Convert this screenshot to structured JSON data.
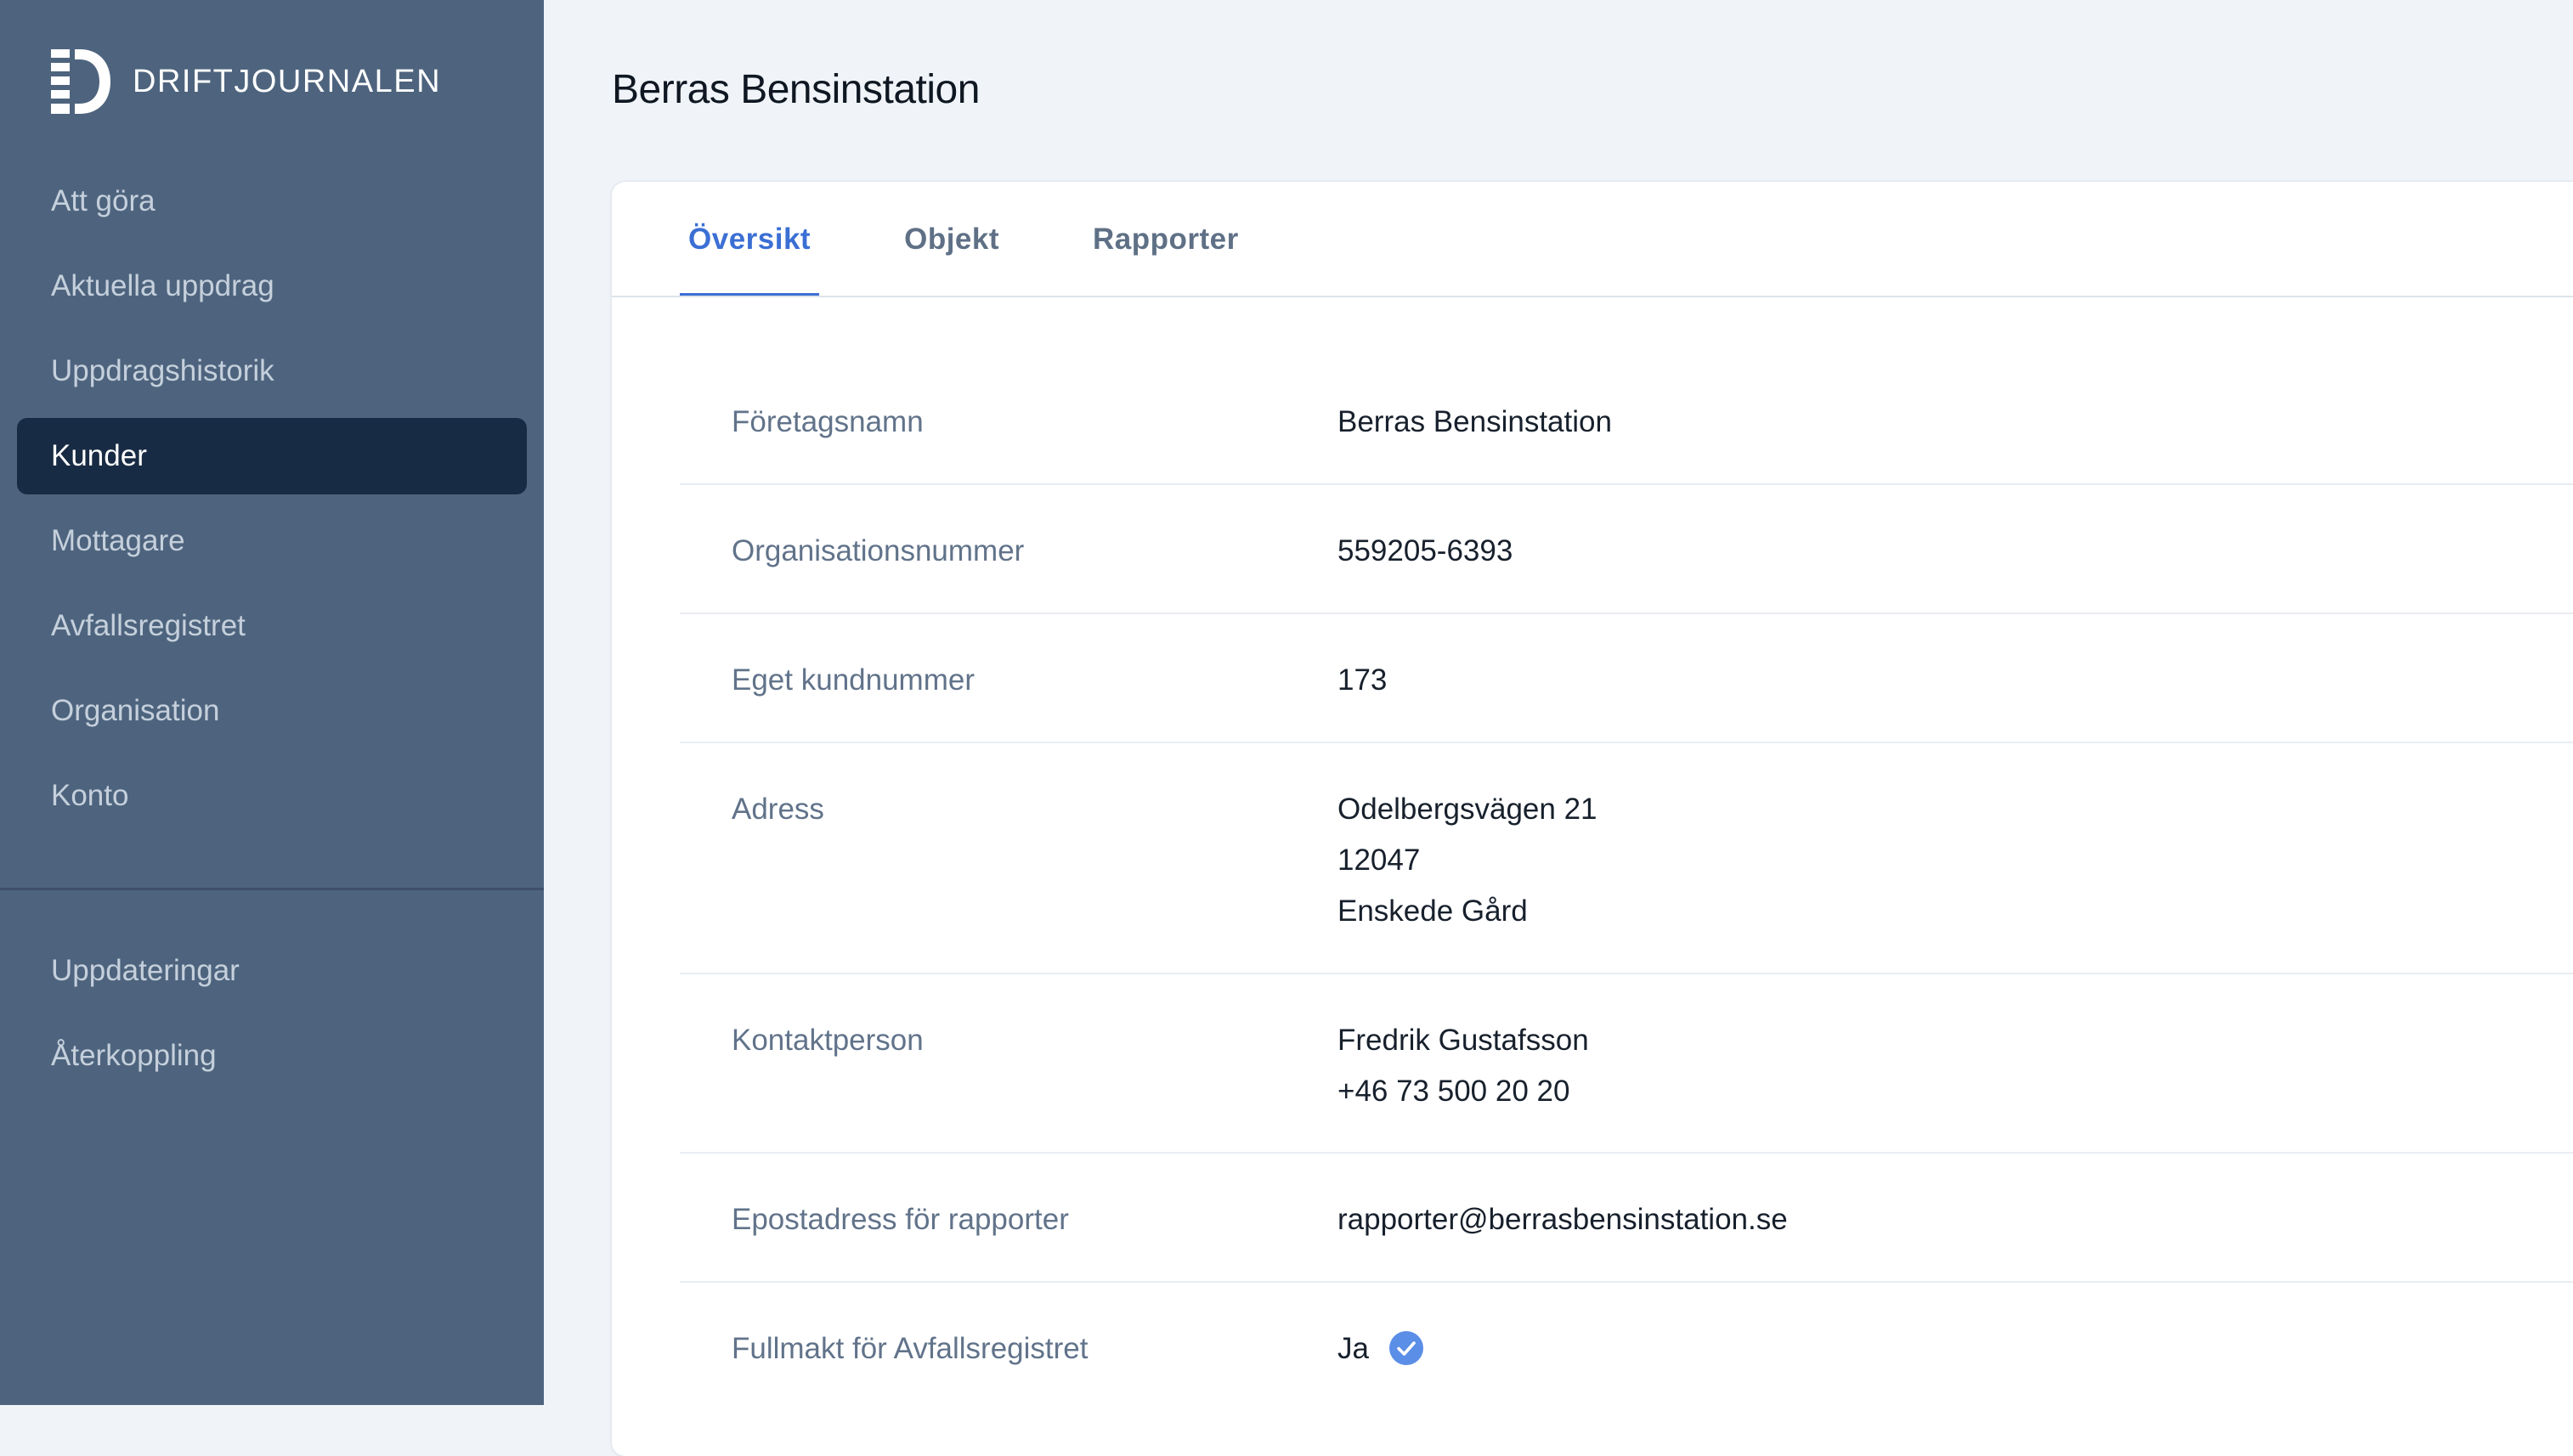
{
  "brand": {
    "name": "DRIFTJOURNALEN",
    "logo_icon": "driftjournalen-logo-icon"
  },
  "sidebar": {
    "items": [
      {
        "label": "Att göra"
      },
      {
        "label": "Aktuella uppdrag"
      },
      {
        "label": "Uppdragshistorik"
      },
      {
        "label": "Kunder",
        "active": true
      },
      {
        "label": "Mottagare"
      },
      {
        "label": "Avfallsregistret"
      },
      {
        "label": "Organisation"
      },
      {
        "label": "Konto"
      }
    ],
    "secondary_items": [
      {
        "label": "Uppdateringar"
      },
      {
        "label": "Återkoppling"
      }
    ]
  },
  "page": {
    "title": "Berras Bensinstation"
  },
  "tabs": [
    {
      "label": "Översikt",
      "active": true
    },
    {
      "label": "Objekt"
    },
    {
      "label": "Rapporter"
    }
  ],
  "details": {
    "company_name": {
      "label": "Företagsnamn",
      "value": "Berras Bensinstation"
    },
    "org_number": {
      "label": "Organisationsnummer",
      "value": "559205-6393"
    },
    "customer_number": {
      "label": "Eget kundnummer",
      "value": "173"
    },
    "address": {
      "label": "Adress",
      "street": "Odelbergsvägen 21",
      "postal_code": "12047",
      "city": "Enskede Gård"
    },
    "contact": {
      "label": "Kontaktperson",
      "name": "Fredrik Gustafsson",
      "phone": "+46 73 500 20 20"
    },
    "report_email": {
      "label": "Epostadress för rapporter",
      "value": "rapporter@berrasbensinstation.se"
    },
    "power_of_attorney": {
      "label": "Fullmakt för Avfallsregistret",
      "value": "Ja",
      "icon": "check-circle-icon"
    }
  },
  "colors": {
    "sidebar_bg": "#4e647e",
    "sidebar_active_bg": "#182b44",
    "accent": "#3b6fd4",
    "check": "#5b8ee6"
  }
}
